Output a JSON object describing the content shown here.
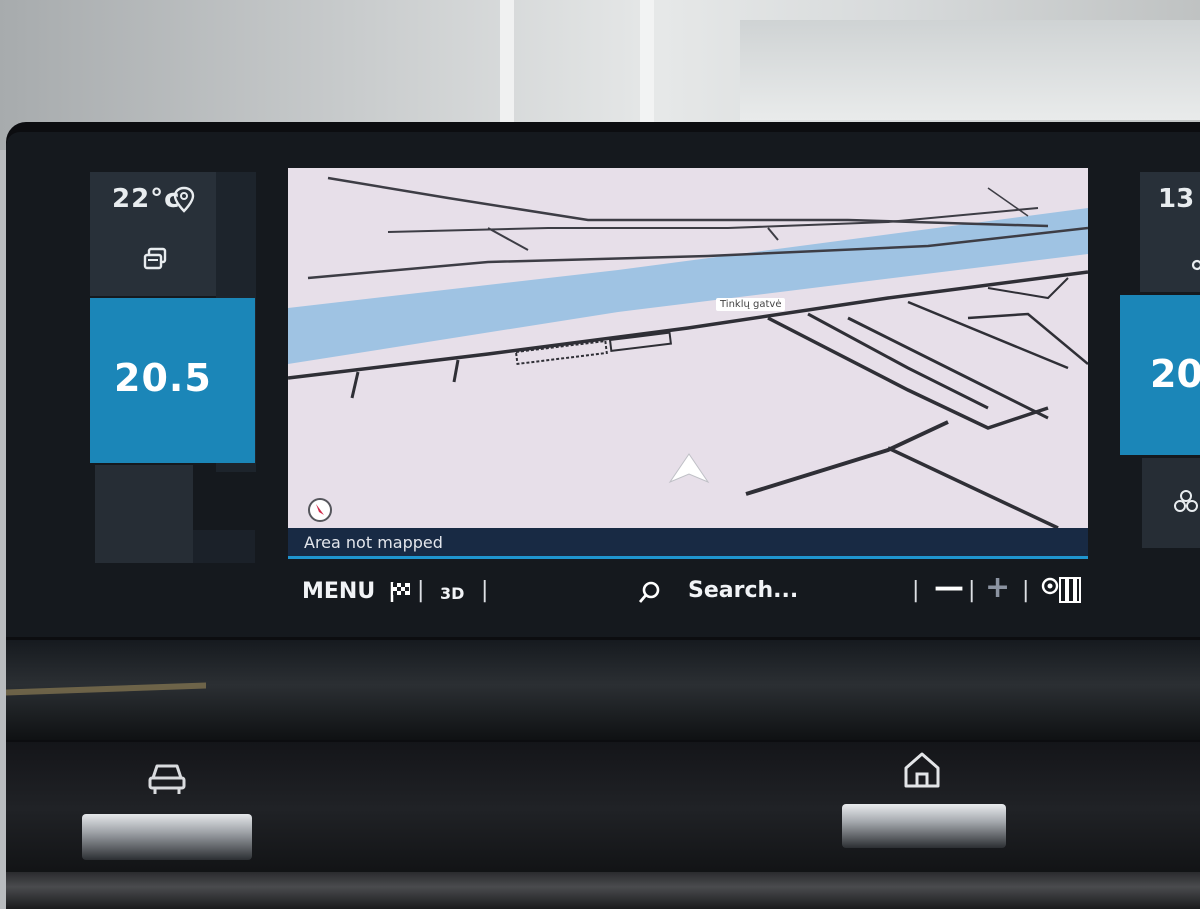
{
  "climate_left": {
    "outside_temp": "22°c",
    "set_temp": "20.5"
  },
  "climate_right": {
    "top_value": "13",
    "set_temp": "20"
  },
  "map": {
    "street_label": "Tinklų gatvė",
    "status": "Area not mapped"
  },
  "toolbar": {
    "menu": "MENU",
    "view_3d": "3D",
    "search": "Search...",
    "separator": "|",
    "zoom_out": "—",
    "zoom_in": "+"
  },
  "colors": {
    "accent_blue": "#1b86b8",
    "status_bar": "#182a44",
    "map_background": "#e7dfe9",
    "river": "#9fc3e3"
  },
  "icons": {
    "location": "location-pin-icon",
    "recirculation": "recirculation-icon",
    "compass": "compass-icon",
    "flag": "checkered-flag-icon",
    "search": "search-icon",
    "traffic": "traffic-icon",
    "car": "car-icon",
    "home": "home-icon",
    "fan": "fan-icon",
    "position": "position-arrow-icon"
  }
}
